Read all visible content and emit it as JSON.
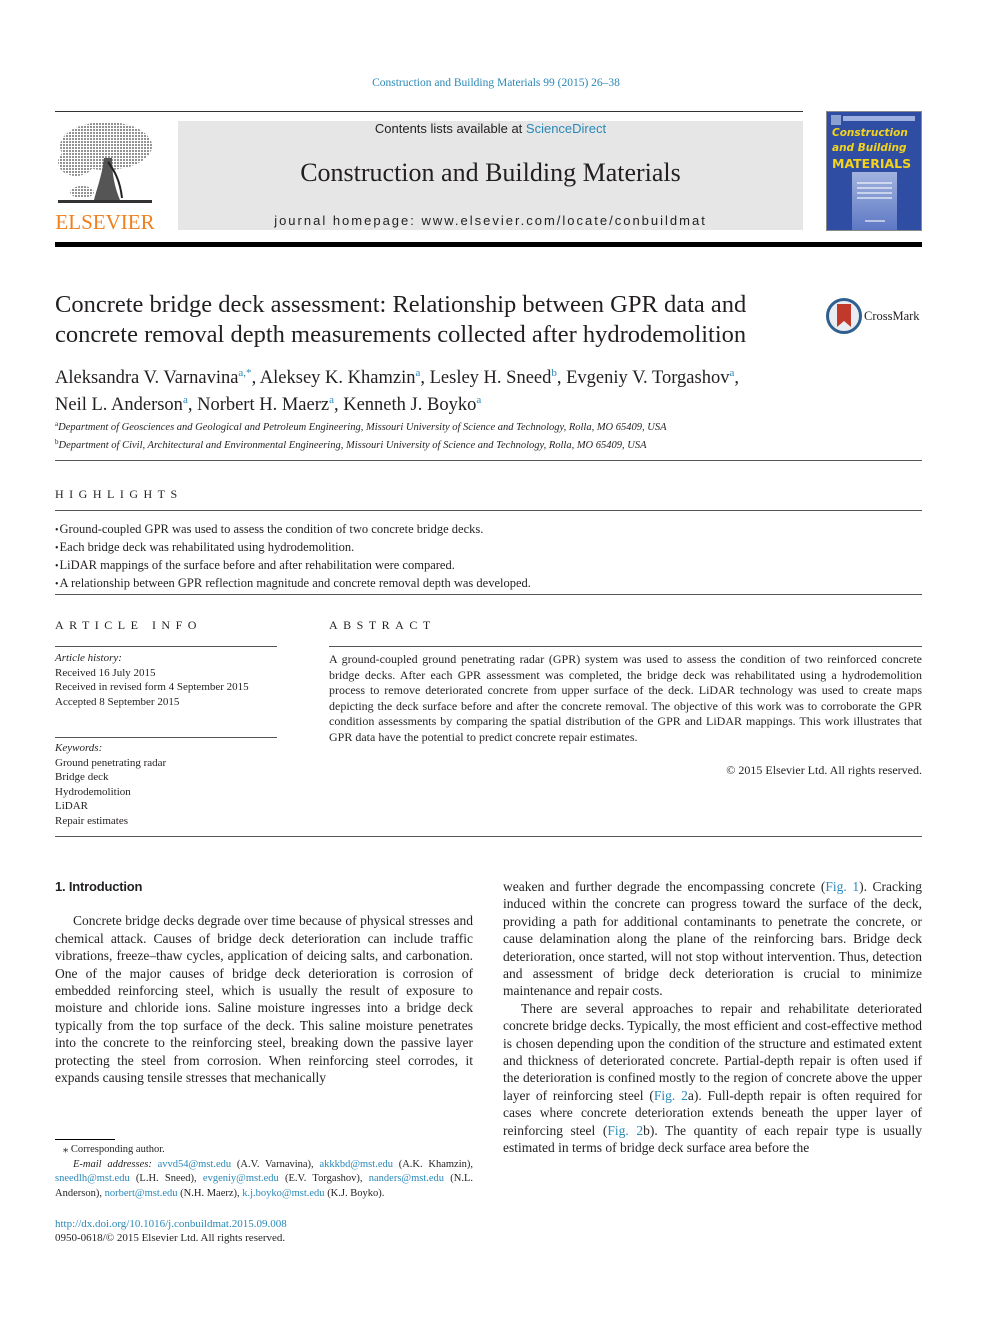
{
  "header": {
    "journal_reference": "Construction and Building Materials 99 (2015) 26–38",
    "publisher_logo_text": "ELSEVIER",
    "contents_prefix": "Contents lists available at ",
    "contents_link": "ScienceDirect",
    "journal_title": "Construction and Building Materials",
    "homepage": "journal homepage: www.elsevier.com/locate/conbuildmat",
    "cover": {
      "line1": "Construction",
      "line2": "and Building",
      "line3": "MATERIALS",
      "bg_color": "#2f4ea3",
      "title_color": "#f4d31c"
    }
  },
  "article": {
    "title": "Concrete bridge deck assessment: Relationship between GPR data and concrete removal depth measurements collected after hydrodemolition",
    "crossmark_label": "CrossMark",
    "authors": [
      {
        "name": "Aleksandra V. Varnavina",
        "sup": "a,*",
        "sep": ", "
      },
      {
        "name": "Aleksey K. Khamzin",
        "sup": "a",
        "sep": ", "
      },
      {
        "name": "Lesley H. Sneed",
        "sup": "b",
        "sep": ", "
      },
      {
        "name": "Evgeniy V. Torgashov",
        "sup": "a",
        "sep": ","
      },
      {
        "name": "Neil L. Anderson",
        "sup": "a",
        "sep": ", "
      },
      {
        "name": "Norbert H. Maerz",
        "sup": "a",
        "sep": ", "
      },
      {
        "name": "Kenneth J. Boyko",
        "sup": "a",
        "sep": ""
      }
    ],
    "affiliations": [
      {
        "sup": "a",
        "text": "Department of Geosciences and Geological and Petroleum Engineering, Missouri University of Science and Technology, Rolla, MO 65409, USA"
      },
      {
        "sup": "b",
        "text": "Department of Civil, Architectural and Environmental Engineering, Missouri University of Science and Technology, Rolla, MO 65409, USA"
      }
    ]
  },
  "highlights": {
    "heading": "HIGHLIGHTS",
    "items": [
      "Ground-coupled GPR was used to assess the condition of two concrete bridge decks.",
      "Each bridge deck was rehabilitated using hydrodemolition.",
      "LiDAR mappings of the surface before and after rehabilitation were compared.",
      "A relationship between GPR reflection magnitude and concrete removal depth was developed."
    ]
  },
  "article_info": {
    "heading": "ARTICLE INFO",
    "history_label": "Article history:",
    "history": [
      "Received 16 July 2015",
      "Received in revised form 4 September 2015",
      "Accepted 8 September 2015"
    ],
    "keywords_label": "Keywords:",
    "keywords": [
      "Ground penetrating radar",
      "Bridge deck",
      "Hydrodemolition",
      "LiDAR",
      "Repair estimates"
    ]
  },
  "abstract": {
    "heading": "ABSTRACT",
    "text": "A ground-coupled ground penetrating radar (GPR) system was used to assess the condition of two reinforced concrete bridge decks. After each GPR assessment was completed, the bridge deck was rehabilitated using a hydrodemolition process to remove deteriorated concrete from upper surface of the deck. LiDAR technology was used to create maps depicting the deck surface before and after the concrete removal. The objective of this work was to corroborate the GPR condition assessments by comparing the spatial distribution of the GPR and LiDAR mappings. This work illustrates that GPR data have the potential to predict concrete repair estimates.",
    "copyright": "© 2015 Elsevier Ltd. All rights reserved."
  },
  "body": {
    "section_heading": "1. Introduction",
    "p1": "Concrete bridge decks degrade over time because of physical stresses and chemical attack. Causes of bridge deck deterioration can include traffic vibrations, freeze–thaw cycles, application of deicing salts, and carbonation. One of the major causes of bridge deck deterioration is corrosion of embedded reinforcing steel, which is usually the result of exposure to moisture and chloride ions. Saline moisture ingresses into a bridge deck typically from the top surface of the deck. This saline moisture penetrates into the concrete to the reinforcing steel, breaking down the passive layer protecting the steel from corrosion. When reinforcing steel corrodes, it expands causing tensile stresses that mechanically",
    "p1_cont_a": "weaken and further degrade the encompassing concrete (",
    "p1_cont_link": "Fig. 1",
    "p1_cont_b": "). Cracking induced within the concrete can progress toward the surface of the deck, providing a path for additional contaminants to penetrate the concrete, or cause delamination along the plane of the reinforcing bars. Bridge deck deterioration, once started, will not stop without intervention. Thus, detection and assessment of bridge deck deterioration is crucial to minimize maintenance and repair costs.",
    "p2_a": "There are several approaches to repair and rehabilitate deteriorated concrete bridge decks. Typically, the most efficient and cost-effective method is chosen depending upon the condition of the structure and estimated extent and thickness of deteriorated concrete. Partial-depth repair is often used if the deterioration is confined mostly to the region of concrete above the upper layer of reinforcing steel (",
    "p2_link1": "Fig. 2",
    "p2_b": "a). Full-depth repair is often required for cases where concrete deterioration extends beneath the upper layer of reinforcing steel (",
    "p2_link2": "Fig. 2",
    "p2_c": "b). The quantity of each repair type is usually estimated in terms of bridge deck surface area before the"
  },
  "footnote": {
    "star": "⁎",
    "corresponding": "Corresponding author.",
    "email_label": "E-mail addresses:",
    "emails": [
      {
        "email": "avvd54@mst.edu",
        "name": "(A.V. Varnavina),"
      },
      {
        "email": "akkkbd@mst.edu",
        "name": "(A.K. Khamzin),"
      },
      {
        "email": "sneedlh@mst.edu",
        "name": "(L.H. Sneed),"
      },
      {
        "email": "evgeniy@mst.edu",
        "name": "(E.V. Torgashov),"
      },
      {
        "email": "nanders@mst.edu",
        "name": "(N.L. Anderson),"
      },
      {
        "email": "norbert@mst.edu",
        "name": "(N.H. Maerz),"
      },
      {
        "email": "k.j.boyko@mst.edu",
        "name": "(K.J. Boyko)."
      }
    ],
    "doi": "http://dx.doi.org/10.1016/j.conbuildmat.2015.09.008",
    "issn": "0950-0618/© 2015 Elsevier Ltd. All rights reserved."
  },
  "colors": {
    "link": "#2a88b8",
    "elsevier_orange": "#f0801e",
    "banner_bg": "#e6e6e6"
  }
}
